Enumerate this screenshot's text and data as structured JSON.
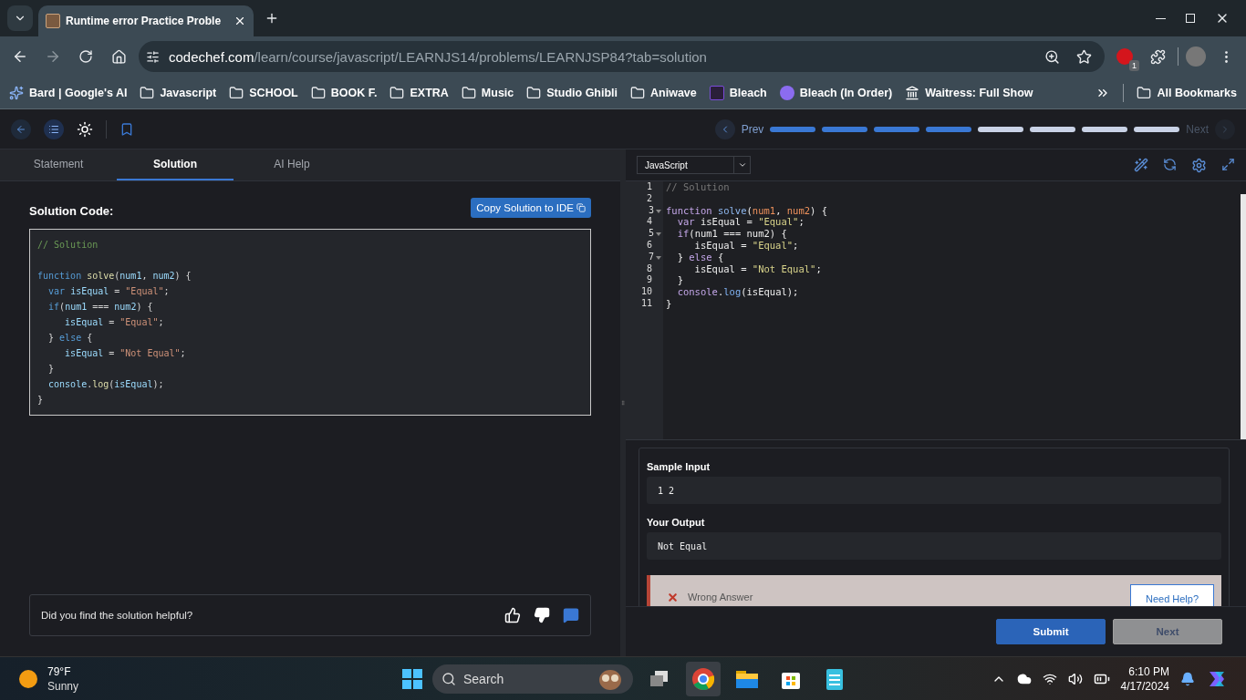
{
  "browser": {
    "tab_title": "Runtime error Practice Proble",
    "url_host": "codechef.com",
    "url_path": "/learn/course/javascript/LEARNJS14/problems/LEARNJSP84?tab=solution",
    "extension_badge": "1",
    "bookmarks": [
      {
        "label": "Bard | Google's AI",
        "kind": "sparkle"
      },
      {
        "label": "Javascript",
        "kind": "folder"
      },
      {
        "label": "SCHOOL",
        "kind": "folder"
      },
      {
        "label": "BOOK F.",
        "kind": "folder"
      },
      {
        "label": "EXTRA",
        "kind": "folder"
      },
      {
        "label": "Music",
        "kind": "folder"
      },
      {
        "label": "Studio Ghibli",
        "kind": "folder"
      },
      {
        "label": "Aniwave",
        "kind": "folder"
      },
      {
        "label": "Bleach",
        "kind": "letter"
      },
      {
        "label": "Bleach (In Order)",
        "kind": "dot"
      },
      {
        "label": "Waitress: Full Show",
        "kind": "building"
      }
    ],
    "all_bookmarks": "All Bookmarks"
  },
  "header": {
    "prev": "Prev",
    "next": "Next",
    "progress": [
      {
        "done": true
      },
      {
        "done": true
      },
      {
        "done": true
      },
      {
        "done": true
      },
      {
        "done": false
      },
      {
        "done": false
      },
      {
        "done": false
      },
      {
        "done": false
      }
    ]
  },
  "left": {
    "tabs": [
      {
        "label": "Statement",
        "selected": false
      },
      {
        "label": "Solution",
        "selected": true
      },
      {
        "label": "AI Help",
        "selected": false
      }
    ],
    "heading": "Solution Code:",
    "copy_button": "Copy Solution to IDE",
    "code": [
      {
        "tokens": [
          {
            "kind": "comment",
            "text": "// Solution"
          }
        ]
      },
      {
        "blank": true
      },
      {
        "tokens": [
          {
            "kind": "keyword",
            "text": "function"
          },
          {
            "kind": "func",
            "text": " solve"
          },
          {
            "kind": "plain",
            "text": "("
          },
          {
            "kind": "param",
            "text": "num1"
          },
          {
            "kind": "plain",
            "text": ", "
          },
          {
            "kind": "param",
            "text": "num2"
          },
          {
            "kind": "plain",
            "text": ") {"
          }
        ]
      },
      {
        "tokens": [
          {
            "kind": "keyword",
            "text": "  var"
          },
          {
            "kind": "variable",
            "text": " isEqual"
          },
          {
            "kind": "plain",
            "text": " = "
          },
          {
            "kind": "string",
            "text": "\"Equal\""
          },
          {
            "kind": "plain",
            "text": ";"
          }
        ]
      },
      {
        "tokens": [
          {
            "kind": "keyword",
            "text": "  if"
          },
          {
            "kind": "plain",
            "text": "("
          },
          {
            "kind": "variable",
            "text": "num1"
          },
          {
            "kind": "plain",
            "text": " === "
          },
          {
            "kind": "variable",
            "text": "num2"
          },
          {
            "kind": "plain",
            "text": ") {"
          }
        ]
      },
      {
        "tokens": [
          {
            "kind": "variable",
            "text": "     isEqual"
          },
          {
            "kind": "plain",
            "text": " = "
          },
          {
            "kind": "string",
            "text": "\"Equal\""
          },
          {
            "kind": "plain",
            "text": ";"
          }
        ]
      },
      {
        "tokens": [
          {
            "kind": "plain",
            "text": "  } "
          },
          {
            "kind": "keyword",
            "text": "else"
          },
          {
            "kind": "plain",
            "text": " {"
          }
        ]
      },
      {
        "tokens": [
          {
            "kind": "variable",
            "text": "     isEqual"
          },
          {
            "kind": "plain",
            "text": " = "
          },
          {
            "kind": "string",
            "text": "\"Not Equal\""
          },
          {
            "kind": "plain",
            "text": ";"
          }
        ]
      },
      {
        "tokens": [
          {
            "kind": "plain",
            "text": "  }"
          }
        ]
      },
      {
        "tokens": [
          {
            "kind": "object",
            "text": "  console"
          },
          {
            "kind": "plain",
            "text": "."
          },
          {
            "kind": "method",
            "text": "log"
          },
          {
            "kind": "plain",
            "text": "("
          },
          {
            "kind": "variable",
            "text": "isEqual"
          },
          {
            "kind": "plain",
            "text": ");"
          }
        ]
      },
      {
        "tokens": [
          {
            "kind": "plain",
            "text": "}"
          }
        ]
      }
    ],
    "feedback": "Did you find the solution helpful?"
  },
  "editor": {
    "language": "JavaScript",
    "lines": [
      {
        "number": "1",
        "foldable": false,
        "tokens": [
          {
            "kind": "comment",
            "text": "// Solution"
          }
        ]
      },
      {
        "number": "2",
        "foldable": false
      },
      {
        "number": "3",
        "foldable": true,
        "tokens": [
          {
            "kind": "keyword",
            "text": "function"
          },
          {
            "kind": "func",
            "text": " solve"
          },
          {
            "kind": "plain",
            "text": "("
          },
          {
            "kind": "param",
            "text": "num1"
          },
          {
            "kind": "plain",
            "text": ", "
          },
          {
            "kind": "param",
            "text": "num2"
          },
          {
            "kind": "plain",
            "text": ") {"
          }
        ]
      },
      {
        "number": "4",
        "foldable": false,
        "tokens": [
          {
            "kind": "keyword",
            "text": "  var"
          },
          {
            "kind": "variable",
            "text": " isEqual"
          },
          {
            "kind": "plain",
            "text": " = "
          },
          {
            "kind": "string",
            "text": "\"Equal\""
          },
          {
            "kind": "plain",
            "text": ";"
          }
        ]
      },
      {
        "number": "5",
        "foldable": true,
        "tokens": [
          {
            "kind": "keyword",
            "text": "  if"
          },
          {
            "kind": "plain",
            "text": "("
          },
          {
            "kind": "variable",
            "text": "num1"
          },
          {
            "kind": "plain",
            "text": " === "
          },
          {
            "kind": "variable",
            "text": "num2"
          },
          {
            "kind": "plain",
            "text": ") {"
          }
        ]
      },
      {
        "number": "6",
        "foldable": false,
        "tokens": [
          {
            "kind": "variable",
            "text": "     isEqual"
          },
          {
            "kind": "plain",
            "text": " = "
          },
          {
            "kind": "string",
            "text": "\"Equal\""
          },
          {
            "kind": "plain",
            "text": ";"
          }
        ]
      },
      {
        "number": "7",
        "foldable": true,
        "tokens": [
          {
            "kind": "plain",
            "text": "  } "
          },
          {
            "kind": "keyword",
            "text": "else"
          },
          {
            "kind": "plain",
            "text": " {"
          }
        ]
      },
      {
        "number": "8",
        "foldable": false,
        "tokens": [
          {
            "kind": "variable",
            "text": "     isEqual"
          },
          {
            "kind": "plain",
            "text": " = "
          },
          {
            "kind": "string",
            "text": "\"Not Equal\""
          },
          {
            "kind": "plain",
            "text": ";"
          }
        ]
      },
      {
        "number": "9",
        "foldable": false,
        "tokens": [
          {
            "kind": "plain",
            "text": "  }"
          }
        ]
      },
      {
        "number": "10",
        "foldable": false,
        "tokens": [
          {
            "kind": "object",
            "text": "  console"
          },
          {
            "kind": "plain",
            "text": "."
          },
          {
            "kind": "method",
            "text": "log"
          },
          {
            "kind": "plain",
            "text": "("
          },
          {
            "kind": "variable",
            "text": "isEqual"
          },
          {
            "kind": "plain",
            "text": ");"
          }
        ]
      },
      {
        "number": "11",
        "foldable": false,
        "tokens": [
          {
            "kind": "plain",
            "text": "}"
          }
        ]
      }
    ]
  },
  "result": {
    "sample_input_label": "Sample Input",
    "sample_input": "1 2",
    "output_label": "Your Output",
    "output": "Not Equal",
    "verdict": "Wrong Answer",
    "help_button": "Need Help?"
  },
  "actions": {
    "submit": "Submit",
    "next": "Next"
  },
  "taskbar": {
    "temperature": "79°F",
    "weather": "Sunny",
    "search": "Search",
    "time": "6:10 PM",
    "date": "4/17/2024"
  }
}
